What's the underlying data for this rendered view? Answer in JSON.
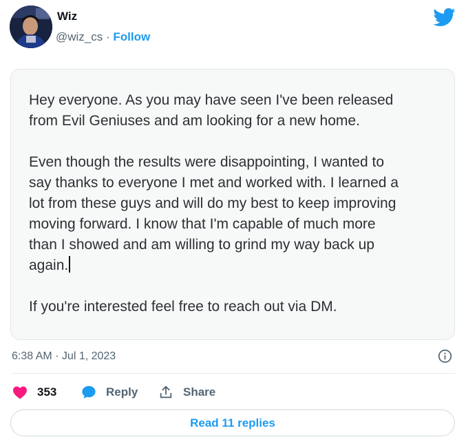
{
  "author": {
    "display_name": "Wiz",
    "handle": "@wiz_cs",
    "separator": " · ",
    "follow_label": "Follow"
  },
  "statement": {
    "paragraph_1": "Hey everyone. As you may have seen I've been released\nfrom Evil Geniuses and am looking for a new home.",
    "paragraph_2": "Even though the results were disappointing, I wanted to\nsay thanks to everyone I met and worked with. I learned a\nlot from these guys and will do my best to keep improving\nmoving forward. I know that I'm capable of much more\nthan I showed and am willing to grind my way back up\nagain.",
    "paragraph_3": "If you're interested feel free to reach out via DM."
  },
  "meta": {
    "timestamp": "6:38 AM · Jul 1, 2023"
  },
  "actions": {
    "like_count": "353",
    "reply_label": "Reply",
    "share_label": "Share"
  },
  "footer": {
    "read_replies_label": "Read 11 replies"
  },
  "colors": {
    "brand_blue": "#1d9bf0",
    "like_pink": "#f91880",
    "secondary_text": "#536471"
  }
}
